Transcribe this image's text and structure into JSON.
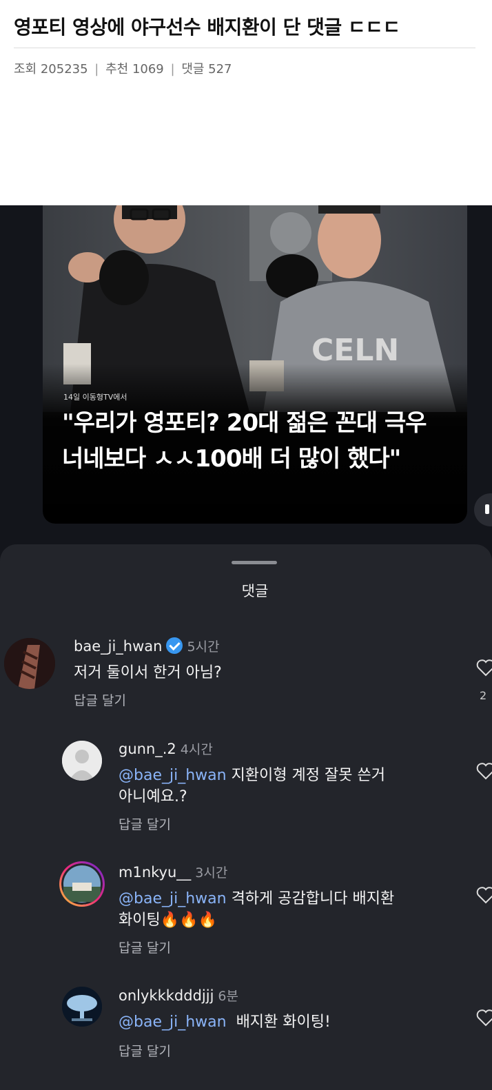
{
  "post": {
    "title": "영포티 영상에 야구선수 배지환이 단 댓글 ㄷㄷㄷ",
    "views_label": "조회 205235",
    "recommend_label": "추천 1069",
    "comments_label": "댓글 527",
    "separator": "|"
  },
  "video": {
    "source": "14일 이동형TV에서",
    "caption_line1": "\"우리가 영포티? 20대 젊은 꼰대 극우",
    "caption_line2": "너네보다 ㅅㅅ100배 더 많이 했다\""
  },
  "sheet": {
    "title": "댓글",
    "reply_label": "답글 달기",
    "comments": [
      {
        "user": "bae_ji_hwan",
        "time": "5시간",
        "verified": true,
        "mention": "",
        "text": "저거 둘이서 한거 아님?",
        "text2": "",
        "likes": "2"
      },
      {
        "user": "gunn_.2",
        "time": "4시간",
        "verified": false,
        "mention": "@bae_ji_hwan",
        "text": " 지환이형 계정 잘못 쓴거",
        "text2": "아니예요.?",
        "likes": ""
      },
      {
        "user": "m1nkyu__",
        "time": "3시간",
        "verified": false,
        "mention": "@bae_ji_hwan",
        "text": " 격하게 공감합니다 배지환",
        "text2": "화이팅🔥🔥🔥",
        "likes": ""
      },
      {
        "user": "onlykkkdddjjj",
        "time": "6분",
        "verified": false,
        "mention": "@bae_ji_hwan",
        "text": "  배지환 화이팅!",
        "text2": "",
        "likes": ""
      }
    ]
  },
  "colors": {
    "sheet_bg": "#23252b",
    "mention": "#8ab4f8",
    "verified": "#3897f0"
  }
}
